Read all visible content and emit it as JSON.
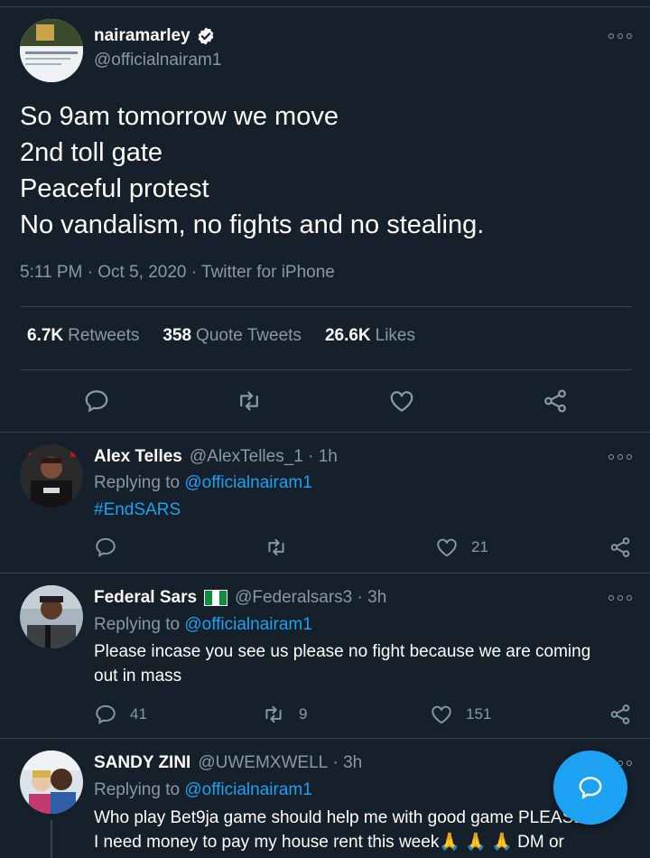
{
  "main_tweet": {
    "display_name": "nairamarley",
    "handle": "@officialnairam1",
    "text_lines": [
      "So 9am tomorrow we move",
      "2nd toll gate",
      "Peaceful protest",
      "No vandalism, no fights and no stealing."
    ],
    "time": "5:11 PM",
    "date": "Oct 5, 2020",
    "source": "Twitter for iPhone",
    "retweets_count": "6.7K",
    "retweets_label": "Retweets",
    "quotes_count": "358",
    "quotes_label": "Quote Tweets",
    "likes_count": "26.6K",
    "likes_label": "Likes"
  },
  "replies": [
    {
      "name": "Alex Telles",
      "handle": "@AlexTelles_1",
      "time": "1h",
      "replying_prefix": "Replying to",
      "replying_to": "@officialnairam1",
      "body": "#EndSARS",
      "reply_count": "",
      "retweet_count": "",
      "like_count": "21"
    },
    {
      "name": "Federal Sars",
      "handle": "@Federalsars3",
      "time": "3h",
      "replying_prefix": "Replying to",
      "replying_to": "@officialnairam1",
      "body": "Please incase you see us please no fight because we are coming out in mass",
      "reply_count": "41",
      "retweet_count": "9",
      "like_count": "151"
    },
    {
      "name": "SANDY ZINI",
      "handle": "@UWEMXWELL",
      "time": "3h",
      "replying_prefix": "Replying to",
      "replying_to": "@officialnairam1",
      "body_line1": "Who play Bet9ja game should help me with good game PLEASE",
      "body_line2": "I need money to pay my house rent this week🙏 🙏 🙏 DM or"
    }
  ],
  "icons": {
    "reply": "reply-icon",
    "retweet": "retweet-icon",
    "like": "like-icon",
    "share": "share-icon",
    "more": "more-icon",
    "verified": "verified-badge-icon",
    "compose": "compose-icon"
  },
  "colors": {
    "background": "#15202b",
    "accent": "#1da1f2",
    "secondary_text": "#8899a6",
    "divider": "#38444d"
  }
}
